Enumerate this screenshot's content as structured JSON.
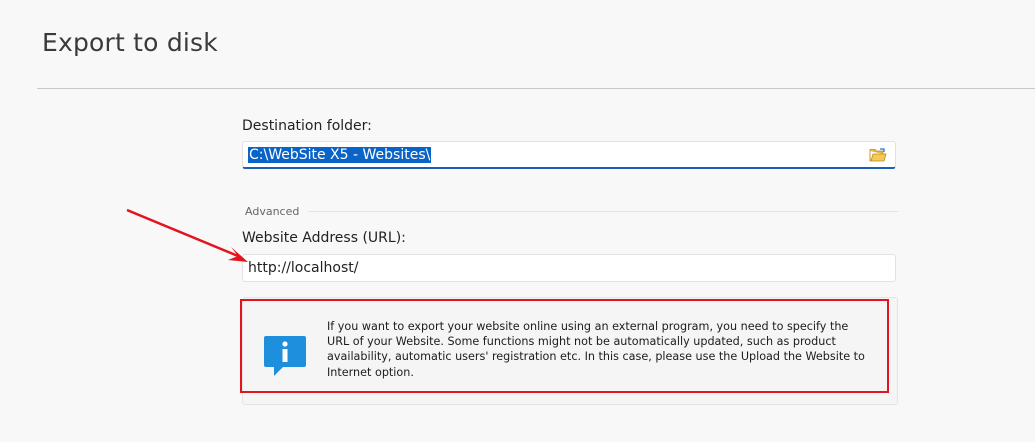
{
  "page": {
    "title": "Export to disk"
  },
  "destination": {
    "label": "Destination folder:",
    "value": "C:\\WebSite X5 - Websites\\",
    "browse_icon": "folder-open-icon"
  },
  "advanced": {
    "section_label": "Advanced",
    "url_label": "Website Address (URL):",
    "url_value": "http://localhost/"
  },
  "info": {
    "icon": "info-icon",
    "text": "If you want to export your website online using an external program, you need to specify the URL of your Website. Some functions might not be automatically updated, such as product availability, automatic users' registration etc. In this case, please use the Upload the Website to Internet option."
  },
  "annotations": {
    "highlight_color": "#e3141e",
    "arrow_color": "#e3141e"
  }
}
